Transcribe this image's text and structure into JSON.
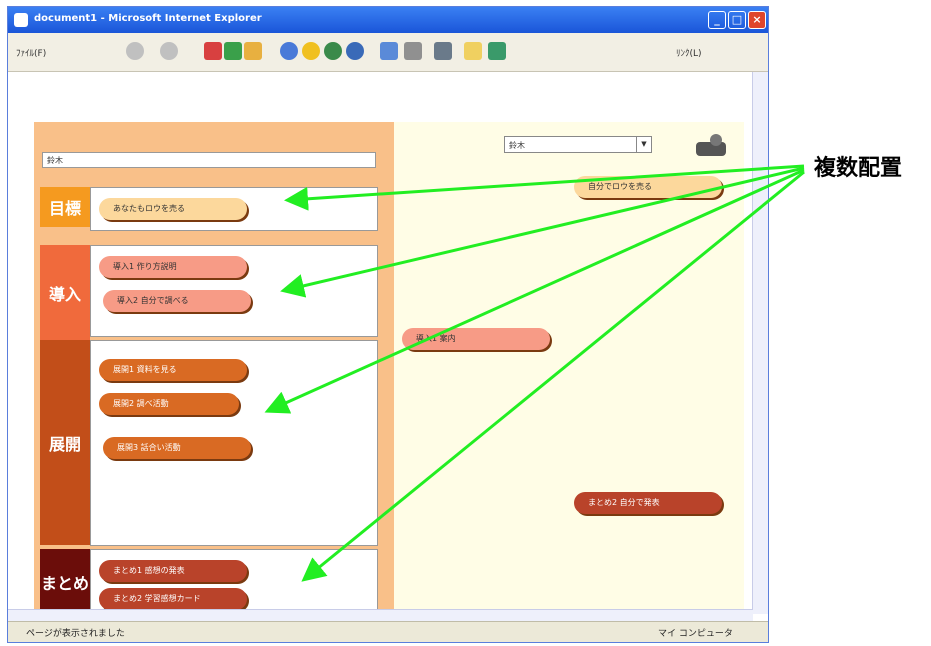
{
  "window": {
    "title": "document1 - Microsoft Internet Explorer",
    "controls": {
      "minimize": "_",
      "maximize": "□",
      "close": "×"
    }
  },
  "toolbar": {
    "file_menu": "ﾌｧｲﾙ(F)",
    "links": "ﾘﾝｸ(L)",
    "icons": [
      "back-icon",
      "forward-icon",
      "stop-icon",
      "refresh-icon",
      "home-icon",
      "search-icon",
      "favorites-icon",
      "media-icon",
      "history-icon",
      "mail-icon",
      "print-icon",
      "edit-icon",
      "folder-icon",
      "messenger-icon"
    ]
  },
  "page": {
    "name_field_value": "鈴木",
    "select_value": "鈴木",
    "sections": [
      {
        "label": "目標",
        "color": "#f59a1f",
        "items": [
          "あなたもロウを売る"
        ]
      },
      {
        "label": "導入",
        "color": "#f06a3c",
        "items": [
          "導入1 作り方説明",
          "導入2 自分で調べる"
        ]
      },
      {
        "label": "展開",
        "color": "#c24e19",
        "items": [
          "展開1 資料を見る",
          "展開2 調べ活動",
          "展開3 話合い活動"
        ]
      },
      {
        "label": "まとめ",
        "color": "#6b0d0a",
        "items": [
          "まとめ1 感想の発表",
          "まとめ2 学習感想カード"
        ]
      }
    ],
    "right_items": [
      {
        "label": "自分でロウを売る",
        "kind": "goal"
      },
      {
        "label": "導入1 案内",
        "kind": "intro"
      },
      {
        "label": "まとめ2 自分で発表",
        "kind": "sum"
      }
    ]
  },
  "status": {
    "left": "ページが表示されました",
    "right": "マイ コンピュータ"
  },
  "annotation": {
    "label": "複数配置",
    "arrow_color": "#22ee22"
  }
}
